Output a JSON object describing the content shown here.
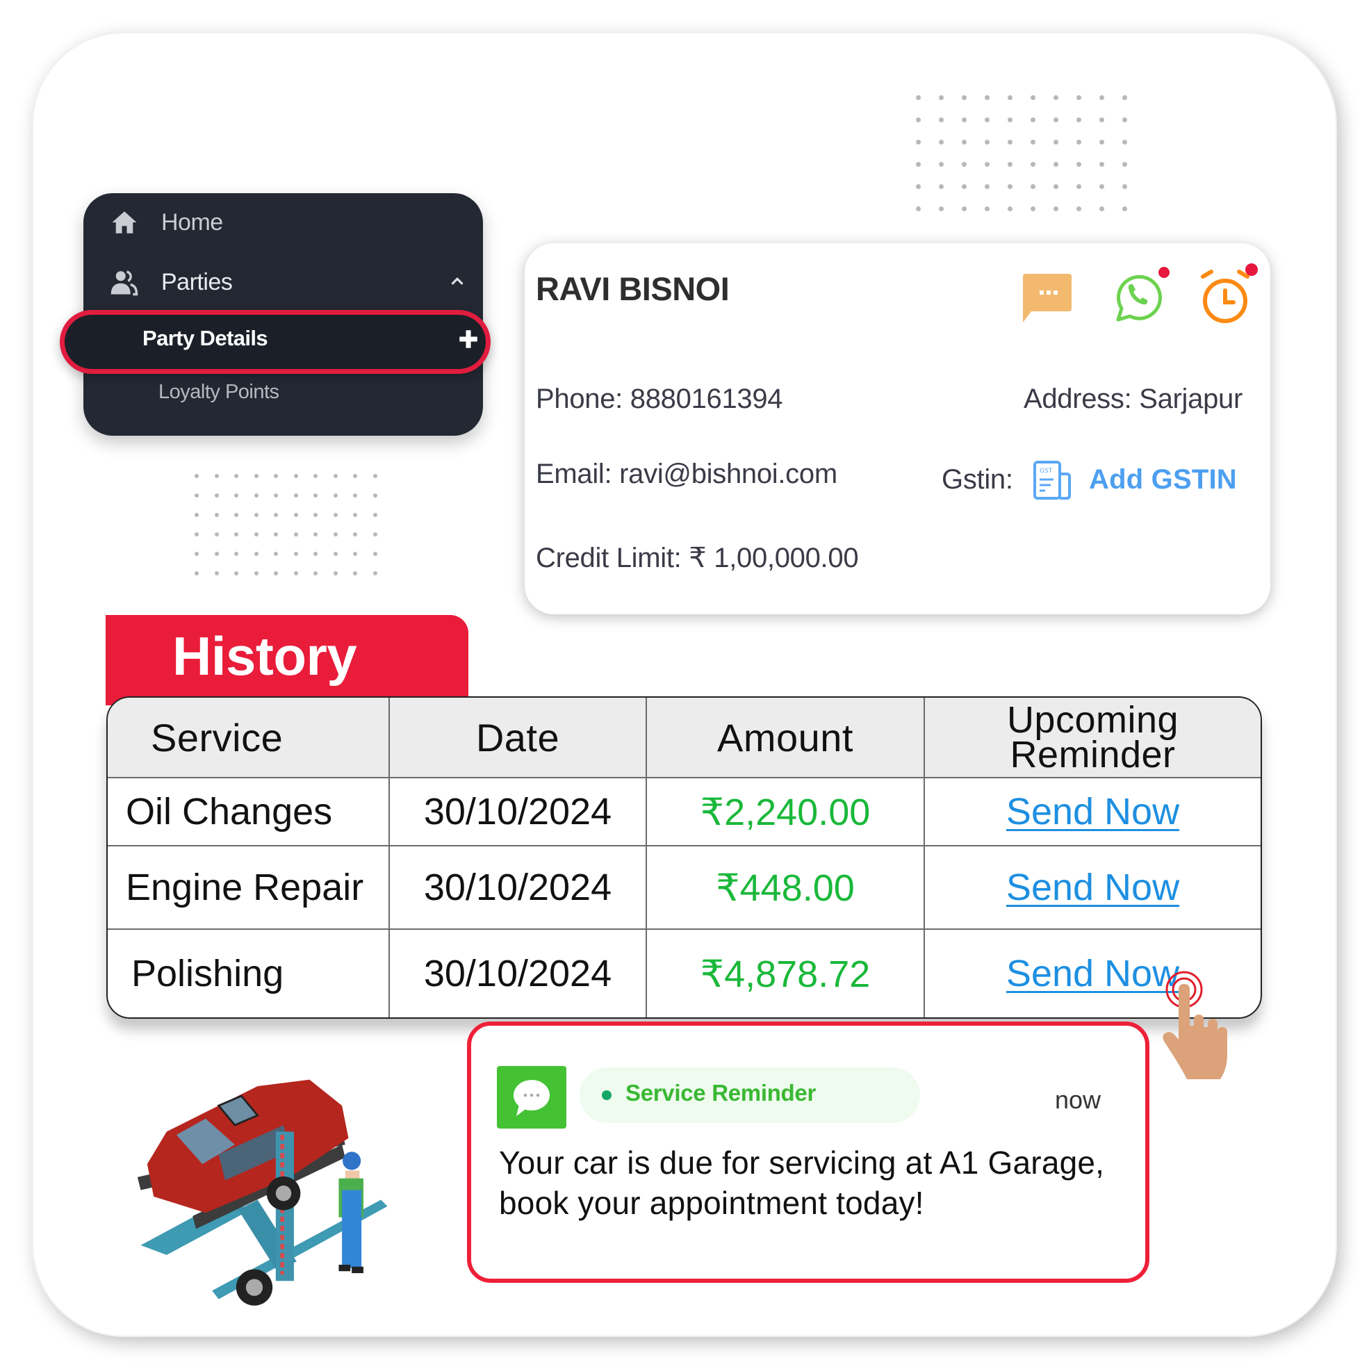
{
  "sidebar": {
    "items": [
      {
        "label": "Home",
        "icon": "home-icon"
      },
      {
        "label": "Parties",
        "icon": "users-icon",
        "expanded": true
      },
      {
        "label": "Party Details",
        "selected": true,
        "action_icon": "plus-icon"
      },
      {
        "label": "Loyalty Points"
      }
    ]
  },
  "profile": {
    "name": "RAVI BISNOI",
    "phone": "Phone: 8880161394",
    "address": "Address: Sarjapur",
    "email": "Email: ravi@bishnoi.com",
    "gstin_label": "Gstin:",
    "gstin_icon_text": "GST",
    "add_gstin": "Add GSTIN",
    "credit_limit": "Credit Limit: ₹ 1,00,000.00",
    "actions": [
      "sms-icon",
      "whatsapp-icon",
      "alarm-icon"
    ]
  },
  "history": {
    "title": "History",
    "columns": [
      "Service",
      "Date",
      "Amount",
      "Upcoming Reminder"
    ],
    "rows": [
      {
        "service": "Oil Changes",
        "date": "30/10/2024",
        "amount": "₹2,240.00",
        "reminder": "Send Now"
      },
      {
        "service": "Engine Repair",
        "date": "30/10/2024",
        "amount": "₹448.00",
        "reminder": "Send Now"
      },
      {
        "service": "Polishing",
        "date": "30/10/2024",
        "amount": "₹4,878.72",
        "reminder": "Send Now"
      }
    ]
  },
  "notification": {
    "app_icon": "message-icon",
    "title": "Service Reminder",
    "time": "now",
    "body": "Your car is due for servicing at A1 Garage, book your appointment today!"
  },
  "colors": {
    "accent_red": "#e91c3a",
    "sidebar_bg": "#232833",
    "amount_green": "#1ab83a",
    "link_blue": "#1d8fe1",
    "gstin_blue": "#4d9ff0",
    "notif_green": "#45c234"
  }
}
